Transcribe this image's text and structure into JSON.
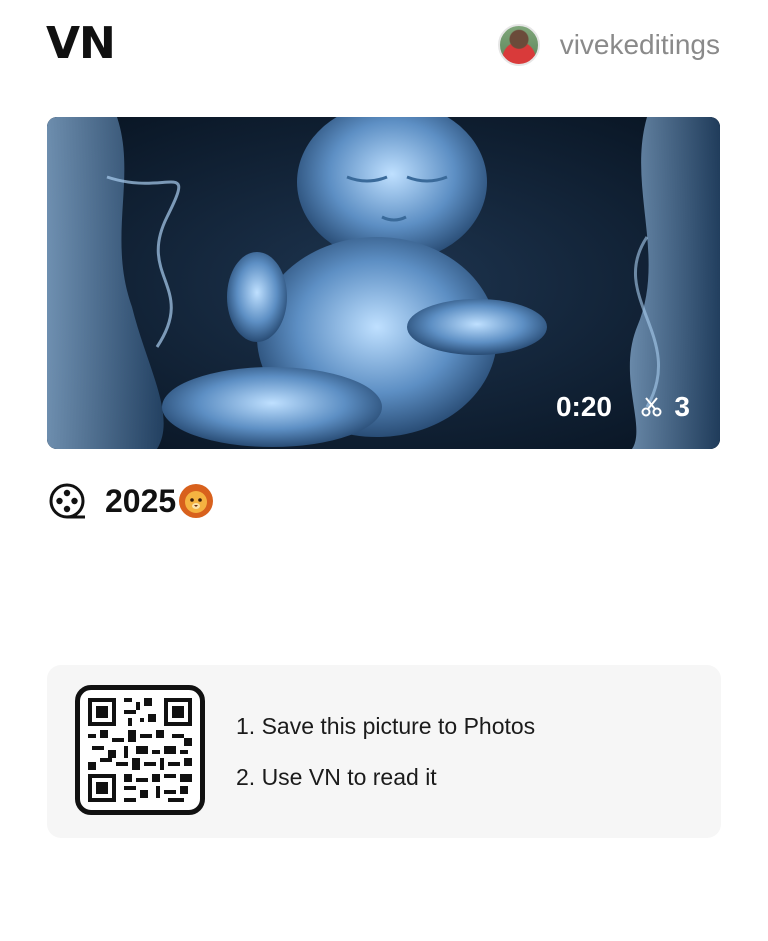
{
  "header": {
    "logo": "VN",
    "username": "vivekeditings"
  },
  "video": {
    "duration": "0:20",
    "clip_count": "3"
  },
  "project": {
    "title": "2025"
  },
  "qr_card": {
    "step1": "1. Save this picture to Photos",
    "step2": "2. Use VN to read it"
  },
  "colors": {
    "accent_text": "#111111",
    "username": "#8a8a8a",
    "card_bg": "#f6f6f6"
  },
  "icons": [
    "avatar",
    "film-reel-icon",
    "lion-emoji-icon",
    "scissors-icon",
    "qr-code-icon"
  ]
}
